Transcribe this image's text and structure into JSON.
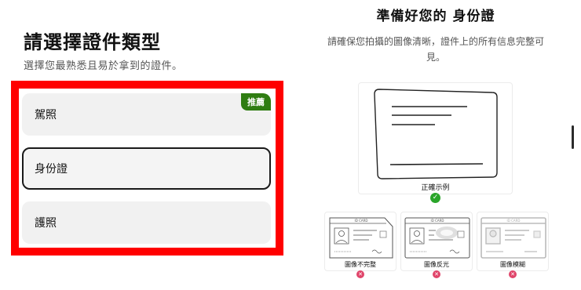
{
  "left": {
    "title": "請選擇證件類型",
    "subtitle": "選擇您最熟悉且易於拿到的證件。",
    "options": [
      {
        "label": "駕照",
        "badge": "推薦"
      },
      {
        "label": "身份證"
      },
      {
        "label": "護照"
      }
    ]
  },
  "right": {
    "title": "準備好您的 身份證",
    "description": "請確保您拍攝的圖像清晰，證件上的所有信息完整可見。",
    "correct_example": {
      "label": "正確示例",
      "icon": "check-icon"
    },
    "bad_examples": [
      {
        "label": "圖像不完整",
        "icon": "error-x-icon",
        "card_text": "ID CARD"
      },
      {
        "label": "圖像反光",
        "icon": "error-x-icon",
        "card_text": "ID CARD"
      },
      {
        "label": "圖像模糊",
        "icon": "error-x-icon",
        "card_text": "ID CARD"
      }
    ]
  },
  "colors": {
    "highlight_frame": "#ff0000",
    "badge": "#2f7d12",
    "success": "#2aa52a",
    "error": "#e0456a"
  }
}
